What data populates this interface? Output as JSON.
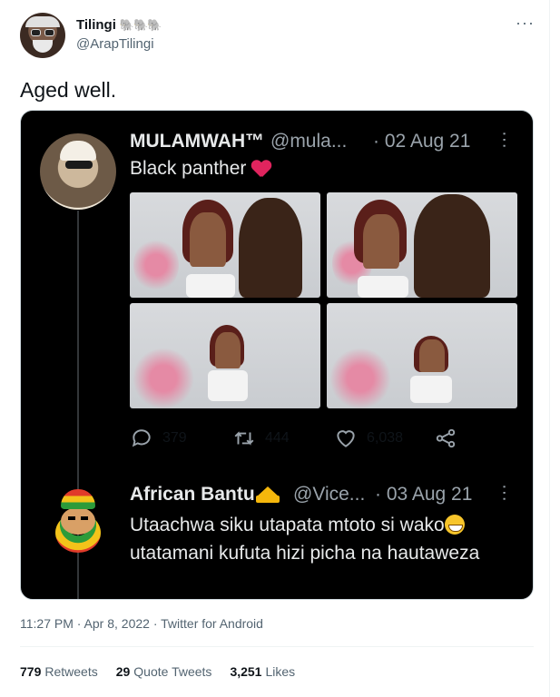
{
  "tweet": {
    "author": {
      "display_name": "Tilingi",
      "name_emojis": "🐘🐘🐘",
      "handle": "@ArapTilingi"
    },
    "more_icon": "more-horizontal-icon",
    "text": "Aged well.",
    "timestamp": "11:27 PM · Apr 8, 2022 · Twitter for Android",
    "stats": {
      "retweets_count": "779",
      "retweets_label": "Retweets",
      "quotes_count": "29",
      "quotes_label": "Quote Tweets",
      "likes_count": "3,251",
      "likes_label": "Likes"
    }
  },
  "embedded": {
    "reply1": {
      "name": "MULAMWAH™",
      "handle": "@mula...",
      "date": "· 02 Aug 21",
      "text": "Black panther",
      "emoji": "red-heart",
      "actions": {
        "replies": "379",
        "retweets": "444",
        "likes": "6,038"
      }
    },
    "reply2": {
      "name": "African Bantu",
      "badge": "crown",
      "handle": "@Vice...",
      "date": "· 03 Aug 21",
      "text_line1": "Utaachwa siku utapata mtoto si wako",
      "emoji": "grinning-squinting-face",
      "text_rest": "utatamani kufuta hizi picha na hautaweza"
    }
  },
  "colors": {
    "text_primary": "#0f1419",
    "text_secondary": "#536471",
    "embed_background": "#000000",
    "embed_text": "#e7e9ea",
    "embed_secondary": "#9aa3ab",
    "heart_red": "#e0245e"
  }
}
